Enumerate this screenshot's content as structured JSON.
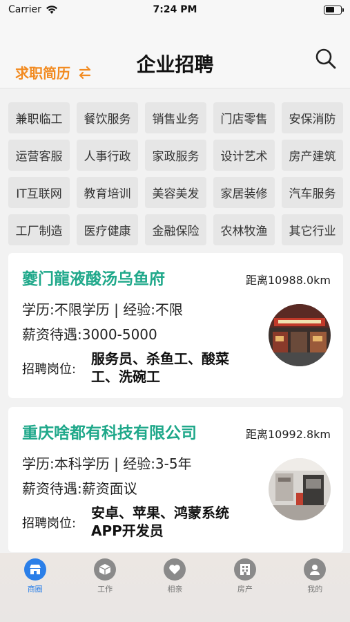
{
  "status": {
    "carrier": "Carrier",
    "time": "7:24 PM"
  },
  "header": {
    "resume_link": "求职简历",
    "title": "企业招聘"
  },
  "categories": [
    "兼职临工",
    "餐饮服务",
    "销售业务",
    "门店零售",
    "安保消防",
    "运营客服",
    "人事行政",
    "家政服务",
    "设计艺术",
    "房产建筑",
    "IT互联网",
    "教育培训",
    "美容美发",
    "家居装修",
    "汽车服务",
    "工厂制造",
    "医疗健康",
    "金融保险",
    "农林牧渔",
    "其它行业"
  ],
  "jobs": [
    {
      "name": "夔门龍液酸汤乌鱼府",
      "distance": "距离10988.0km",
      "edu_exp": "学历:不限学历 | 经验:不限",
      "salary": "薪资待遇:3000-5000",
      "positions_label": "招聘岗位:",
      "positions": "服务员、杀鱼工、酸菜工、洗碗工"
    },
    {
      "name": "重庆啥都有科技有限公司",
      "distance": "距离10992.8km",
      "edu_exp": "学历:本科学历 | 经验:3-5年",
      "salary": "薪资待遇:薪资面议",
      "positions_label": "招聘岗位:",
      "positions": "安卓、苹果、鸿蒙系统APP开发员"
    }
  ],
  "tabs": [
    {
      "label": "商圈",
      "icon": "shop-icon",
      "active": true
    },
    {
      "label": "工作",
      "icon": "box-icon",
      "active": false
    },
    {
      "label": "相亲",
      "icon": "heart-icon",
      "active": false
    },
    {
      "label": "房产",
      "icon": "building-icon",
      "active": false
    },
    {
      "label": "我的",
      "icon": "user-icon",
      "active": false
    }
  ],
  "colors": {
    "accent_orange": "#f28a1f",
    "company_green": "#1fa88a",
    "tab_active": "#2b7fe8"
  }
}
